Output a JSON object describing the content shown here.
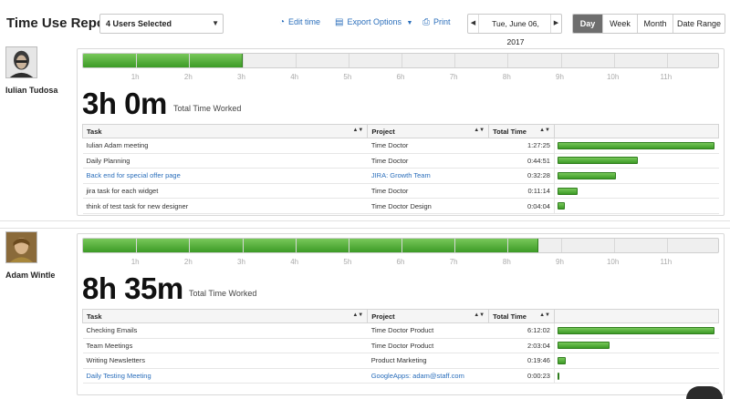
{
  "header": {
    "title": "Time Use Report",
    "users_select": "4 Users Selected",
    "edit_time": "Edit time",
    "export_options": "Export Options",
    "print": "Print",
    "date": "Tue, June 06, 2017",
    "ranges": [
      {
        "label": "Day",
        "active": true
      },
      {
        "label": "Week",
        "active": false
      },
      {
        "label": "Month",
        "active": false
      },
      {
        "label": "Date Range",
        "active": false
      }
    ]
  },
  "hour_labels": [
    "1h",
    "2h",
    "3h",
    "4h",
    "5h",
    "6h",
    "7h",
    "8h",
    "9h",
    "10h",
    "11h"
  ],
  "table_headers": {
    "task": "Task",
    "project": "Project",
    "total_time": "Total Time"
  },
  "users": [
    {
      "name": "Iulian Tudosa",
      "total": "3h 0m",
      "total_label": "Total Time Worked",
      "hours_worked": 3.0,
      "tasks": [
        {
          "task": "Iulian Adam meeting",
          "project": "Time Doctor",
          "time": "1:27:25",
          "fraction": 1.0,
          "link": false
        },
        {
          "task": "Daily Planning",
          "project": "Time Doctor",
          "time": "0:44:51",
          "fraction": 0.513,
          "link": false
        },
        {
          "task": "Back end for special offer page",
          "project": "JIRA: Growth Team",
          "time": "0:32:28",
          "fraction": 0.371,
          "link": true
        },
        {
          "task": "jira task for each widget",
          "project": "Time Doctor",
          "time": "0:11:14",
          "fraction": 0.128,
          "link": false
        },
        {
          "task": "think of test task for new designer",
          "project": "Time Doctor Design",
          "time": "0:04:04",
          "fraction": 0.046,
          "link": false
        }
      ]
    },
    {
      "name": "Adam Wintle",
      "total": "8h 35m",
      "total_label": "Total Time Worked",
      "hours_worked": 8.58,
      "tasks": [
        {
          "task": "Checking Emails",
          "project": "Time Doctor Product",
          "time": "6:12:02",
          "fraction": 1.0,
          "link": false
        },
        {
          "task": "Team Meetings",
          "project": "Time Doctor Product",
          "time": "2:03:04",
          "fraction": 0.331,
          "link": false
        },
        {
          "task": "Writing Newsletters",
          "project": "Product Marketing",
          "time": "0:19:46",
          "fraction": 0.053,
          "link": false
        },
        {
          "task": "Daily Testing Meeting",
          "project": "GoogleApps: adam@staff.com",
          "time": "0:00:23",
          "fraction": 0.001,
          "link": true
        }
      ]
    }
  ],
  "icons": {
    "edit": "edit-time-icon",
    "export": "export-icon",
    "print": "print-icon",
    "prev": "arrow-left-icon",
    "next": "arrow-right-icon",
    "dropdown": "chevron-down-icon",
    "sort": "sort-icon",
    "chat": "chat-bubble-icon"
  }
}
